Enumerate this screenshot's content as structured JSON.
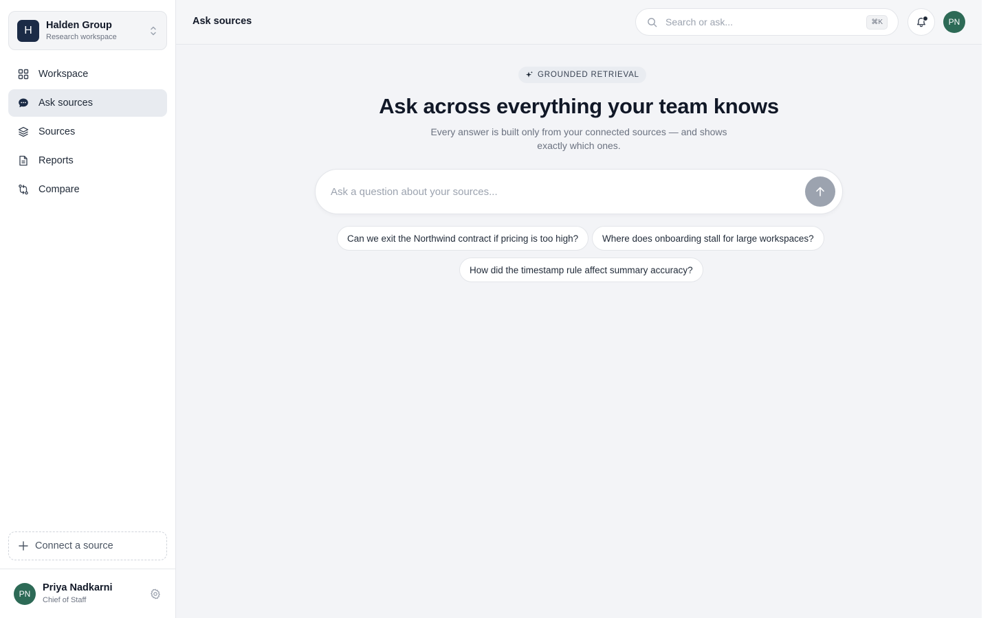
{
  "workspace": {
    "logo_letter": "H",
    "name": "Halden Group",
    "subtitle": "Research workspace"
  },
  "sidebar": {
    "items": [
      {
        "label": "Workspace",
        "icon": "grid-icon",
        "active": false
      },
      {
        "label": "Ask sources",
        "icon": "chat-icon",
        "active": true
      },
      {
        "label": "Sources",
        "icon": "layers-icon",
        "active": false
      },
      {
        "label": "Reports",
        "icon": "document-icon",
        "active": false
      },
      {
        "label": "Compare",
        "icon": "compare-icon",
        "active": false
      }
    ],
    "connect_label": "Connect a source"
  },
  "user": {
    "initials": "PN",
    "name": "Priya Nadkarni",
    "role": "Chief of Staff"
  },
  "topbar": {
    "title": "Ask sources",
    "search_placeholder": "Search or ask...",
    "shortcut": "⌘K",
    "avatar_initials": "PN"
  },
  "hero": {
    "badge": "GROUNDED RETRIEVAL",
    "title": "Ask across everything your team knows",
    "subtitle": "Every answer is built only from your connected sources — and shows exactly which ones.",
    "ask_placeholder": "Ask a question about your sources...",
    "suggestions": [
      "Can we exit the Northwind contract if pricing is too high?",
      "Where does onboarding stall for large workspaces?",
      "How did the timestamp rule affect summary accuracy?"
    ]
  },
  "colors": {
    "brand": "#1b2b46",
    "avatar": "#2d6a56",
    "send_disabled": "#9ca3af"
  }
}
